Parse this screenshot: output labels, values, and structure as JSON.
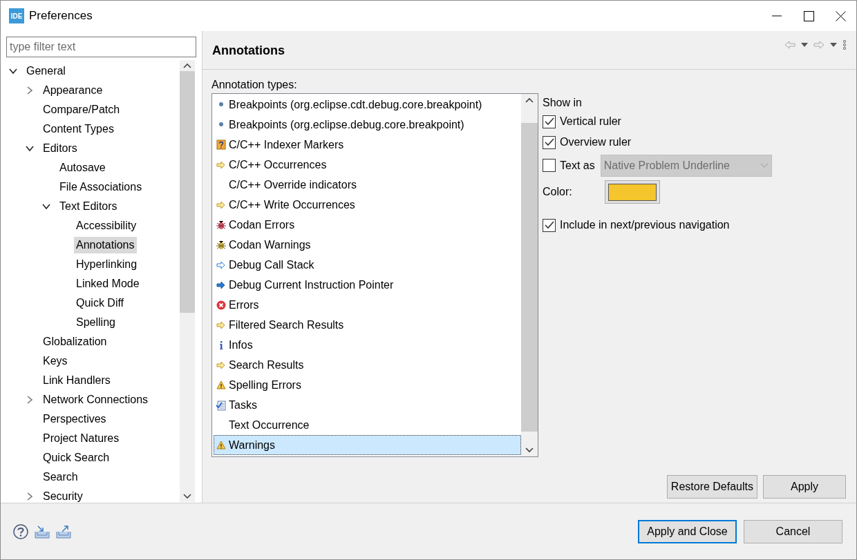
{
  "window": {
    "title": "Preferences",
    "logo": "IDE"
  },
  "filter": {
    "placeholder": "type filter text"
  },
  "tree": [
    {
      "label": "General",
      "expanded": true,
      "selected": false,
      "children": [
        {
          "label": "Appearance",
          "expanded": false,
          "selected": false
        },
        {
          "label": "Compare/Patch",
          "selected": false
        },
        {
          "label": "Content Types",
          "selected": false
        },
        {
          "label": "Editors",
          "expanded": true,
          "selected": false,
          "children": [
            {
              "label": "Autosave",
              "selected": false
            },
            {
              "label": "File Associations",
              "selected": false
            },
            {
              "label": "Text Editors",
              "expanded": true,
              "selected": false,
              "children": [
                {
                  "label": "Accessibility",
                  "selected": false
                },
                {
                  "label": "Annotations",
                  "selected": true
                },
                {
                  "label": "Hyperlinking",
                  "selected": false
                },
                {
                  "label": "Linked Mode",
                  "selected": false
                },
                {
                  "label": "Quick Diff",
                  "selected": false
                },
                {
                  "label": "Spelling",
                  "selected": false
                }
              ]
            }
          ]
        },
        {
          "label": "Globalization",
          "selected": false
        },
        {
          "label": "Keys",
          "selected": false
        },
        {
          "label": "Link Handlers",
          "selected": false
        },
        {
          "label": "Network Connections",
          "expanded": false,
          "selected": false
        },
        {
          "label": "Perspectives",
          "selected": false
        },
        {
          "label": "Project Natures",
          "selected": false
        },
        {
          "label": "Quick Search",
          "selected": false
        },
        {
          "label": "Search",
          "selected": false
        },
        {
          "label": "Security",
          "expanded": false,
          "selected": false
        }
      ]
    }
  ],
  "page": {
    "title": "Annotations",
    "types_label": "Annotation types:",
    "types": [
      {
        "label": "Breakpoints (org.eclipse.cdt.debug.core.breakpoint)",
        "kind": "dot",
        "selected": false
      },
      {
        "label": "Breakpoints (org.eclipse.debug.core.breakpoint)",
        "kind": "dot",
        "selected": false
      },
      {
        "label": "C/C++ Indexer Markers",
        "kind": "help",
        "selected": false
      },
      {
        "label": "C/C++ Occurrences",
        "kind": "arrow",
        "selected": false
      },
      {
        "label": "C/C++ Override indicators",
        "kind": "none",
        "selected": false
      },
      {
        "label": "C/C++ Write Occurrences",
        "kind": "arrow",
        "selected": false
      },
      {
        "label": "Codan Errors",
        "kind": "bug-red",
        "selected": false
      },
      {
        "label": "Codan Warnings",
        "kind": "bug-yellow",
        "selected": false
      },
      {
        "label": "Debug Call Stack",
        "kind": "arrow-blue-outline",
        "selected": false
      },
      {
        "label": "Debug Current Instruction Pointer",
        "kind": "arrow-blue",
        "selected": false
      },
      {
        "label": "Errors",
        "kind": "error",
        "selected": false
      },
      {
        "label": "Filtered Search Results",
        "kind": "arrow",
        "selected": false
      },
      {
        "label": "Infos",
        "kind": "info",
        "selected": false
      },
      {
        "label": "Search Results",
        "kind": "arrow",
        "selected": false
      },
      {
        "label": "Spelling Errors",
        "kind": "warning",
        "selected": false
      },
      {
        "label": "Tasks",
        "kind": "tasks",
        "selected": false
      },
      {
        "label": "Text Occurrence",
        "kind": "none",
        "selected": false
      },
      {
        "label": "Warnings",
        "kind": "warning",
        "selected": true
      }
    ],
    "show_in_label": "Show in",
    "vertical_ruler": {
      "label": "Vertical ruler",
      "checked": true
    },
    "overview_ruler": {
      "label": "Overview ruler",
      "checked": true
    },
    "text_as": {
      "label": "Text as",
      "checked": false,
      "value": "Native Problem Underline",
      "disabled": true
    },
    "color": {
      "label": "Color:",
      "color": "#f4c52c"
    },
    "include_nav": {
      "label": "Include in next/previous navigation",
      "checked": true
    },
    "buttons": [
      "Restore Defaults",
      "Apply"
    ]
  },
  "footer_buttons": [
    {
      "label": "Apply and Close",
      "default": true
    },
    {
      "label": "Cancel",
      "default": false
    }
  ]
}
